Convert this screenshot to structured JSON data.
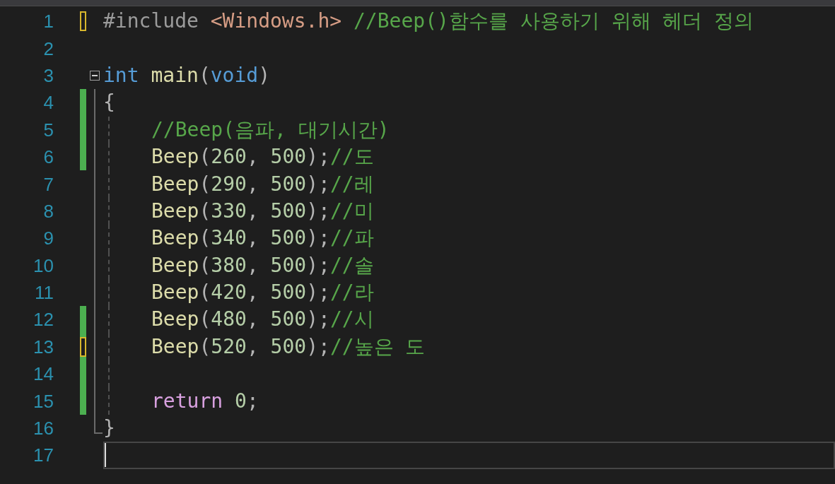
{
  "editor": {
    "lines": [
      {
        "number": "1",
        "change_bar": false,
        "unsaved_marker": true,
        "fold_start": false,
        "fold_end": false,
        "indented": false,
        "current": false,
        "tokens": [
          {
            "kind": "preprocessor",
            "text": "#include "
          },
          {
            "kind": "include",
            "text": "<Windows.h>"
          },
          {
            "kind": "comment",
            "text": " //Beep()함수를 사용하기 위해 헤더 정의"
          }
        ]
      },
      {
        "number": "2",
        "change_bar": false,
        "unsaved_marker": false,
        "fold_start": false,
        "fold_end": false,
        "indented": false,
        "current": false
      },
      {
        "number": "3",
        "change_bar": false,
        "unsaved_marker": false,
        "fold_start": true,
        "fold_end": false,
        "indented": false,
        "current": false,
        "tokens": [
          {
            "kind": "keyword",
            "text": "int"
          },
          {
            "kind": "function",
            "text": " main"
          },
          {
            "kind": "punct",
            "text": "("
          },
          {
            "kind": "keyword",
            "text": "void"
          },
          {
            "kind": "punct",
            "text": ")"
          }
        ]
      },
      {
        "number": "4",
        "change_bar": true,
        "unsaved_marker": false,
        "fold_start": false,
        "fold_end": false,
        "indented": false,
        "current": false,
        "tokens": [
          {
            "kind": "punct",
            "text": "{"
          }
        ]
      },
      {
        "number": "5",
        "change_bar": true,
        "unsaved_marker": false,
        "fold_start": false,
        "fold_end": false,
        "indented": true,
        "current": false,
        "tokens": [
          {
            "kind": "comment",
            "text": "//Beep(음파, 대기시간)"
          }
        ]
      },
      {
        "number": "6",
        "change_bar": true,
        "unsaved_marker": false,
        "fold_start": false,
        "fold_end": false,
        "indented": true,
        "current": false,
        "tokens": [
          {
            "kind": "function",
            "text": "Beep"
          },
          {
            "kind": "punct",
            "text": "("
          },
          {
            "kind": "number",
            "text": "260"
          },
          {
            "kind": "punct",
            "text": ", "
          },
          {
            "kind": "number",
            "text": "500"
          },
          {
            "kind": "punct",
            "text": ");"
          },
          {
            "kind": "comment",
            "text": "//도"
          }
        ]
      },
      {
        "number": "7",
        "change_bar": false,
        "unsaved_marker": false,
        "fold_start": false,
        "fold_end": false,
        "indented": true,
        "current": false,
        "tokens": [
          {
            "kind": "function",
            "text": "Beep"
          },
          {
            "kind": "punct",
            "text": "("
          },
          {
            "kind": "number",
            "text": "290"
          },
          {
            "kind": "punct",
            "text": ", "
          },
          {
            "kind": "number",
            "text": "500"
          },
          {
            "kind": "punct",
            "text": ");"
          },
          {
            "kind": "comment",
            "text": "//레"
          }
        ]
      },
      {
        "number": "8",
        "change_bar": false,
        "unsaved_marker": false,
        "fold_start": false,
        "fold_end": false,
        "indented": true,
        "current": false,
        "tokens": [
          {
            "kind": "function",
            "text": "Beep"
          },
          {
            "kind": "punct",
            "text": "("
          },
          {
            "kind": "number",
            "text": "330"
          },
          {
            "kind": "punct",
            "text": ", "
          },
          {
            "kind": "number",
            "text": "500"
          },
          {
            "kind": "punct",
            "text": ");"
          },
          {
            "kind": "comment",
            "text": "//미"
          }
        ]
      },
      {
        "number": "9",
        "change_bar": false,
        "unsaved_marker": false,
        "fold_start": false,
        "fold_end": false,
        "indented": true,
        "current": false,
        "tokens": [
          {
            "kind": "function",
            "text": "Beep"
          },
          {
            "kind": "punct",
            "text": "("
          },
          {
            "kind": "number",
            "text": "340"
          },
          {
            "kind": "punct",
            "text": ", "
          },
          {
            "kind": "number",
            "text": "500"
          },
          {
            "kind": "punct",
            "text": ");"
          },
          {
            "kind": "comment",
            "text": "//파"
          }
        ]
      },
      {
        "number": "10",
        "change_bar": false,
        "unsaved_marker": false,
        "fold_start": false,
        "fold_end": false,
        "indented": true,
        "current": false,
        "tokens": [
          {
            "kind": "function",
            "text": "Beep"
          },
          {
            "kind": "punct",
            "text": "("
          },
          {
            "kind": "number",
            "text": "380"
          },
          {
            "kind": "punct",
            "text": ", "
          },
          {
            "kind": "number",
            "text": "500"
          },
          {
            "kind": "punct",
            "text": ");"
          },
          {
            "kind": "comment",
            "text": "//솔"
          }
        ]
      },
      {
        "number": "11",
        "change_bar": false,
        "unsaved_marker": false,
        "fold_start": false,
        "fold_end": false,
        "indented": true,
        "current": false,
        "tokens": [
          {
            "kind": "function",
            "text": "Beep"
          },
          {
            "kind": "punct",
            "text": "("
          },
          {
            "kind": "number",
            "text": "420"
          },
          {
            "kind": "punct",
            "text": ", "
          },
          {
            "kind": "number",
            "text": "500"
          },
          {
            "kind": "punct",
            "text": ");"
          },
          {
            "kind": "comment",
            "text": "//라"
          }
        ]
      },
      {
        "number": "12",
        "change_bar": true,
        "unsaved_marker": false,
        "fold_start": false,
        "fold_end": false,
        "indented": true,
        "current": false,
        "tokens": [
          {
            "kind": "function",
            "text": "Beep"
          },
          {
            "kind": "punct",
            "text": "("
          },
          {
            "kind": "number",
            "text": "480"
          },
          {
            "kind": "punct",
            "text": ", "
          },
          {
            "kind": "number",
            "text": "500"
          },
          {
            "kind": "punct",
            "text": ");"
          },
          {
            "kind": "comment",
            "text": "//시"
          }
        ]
      },
      {
        "number": "13",
        "change_bar": true,
        "unsaved_marker": true,
        "fold_start": false,
        "fold_end": false,
        "indented": true,
        "current": false,
        "tokens": [
          {
            "kind": "function",
            "text": "Beep"
          },
          {
            "kind": "punct",
            "text": "("
          },
          {
            "kind": "number",
            "text": "520"
          },
          {
            "kind": "punct",
            "text": ", "
          },
          {
            "kind": "number",
            "text": "500"
          },
          {
            "kind": "punct",
            "text": ");"
          },
          {
            "kind": "comment",
            "text": "//높은 도"
          }
        ]
      },
      {
        "number": "14",
        "change_bar": true,
        "unsaved_marker": false,
        "fold_start": false,
        "fold_end": false,
        "indented": true,
        "current": false
      },
      {
        "number": "15",
        "change_bar": true,
        "unsaved_marker": false,
        "fold_start": false,
        "fold_end": false,
        "indented": true,
        "current": false,
        "tokens": [
          {
            "kind": "control",
            "text": "return"
          },
          {
            "kind": "number",
            "text": " 0"
          },
          {
            "kind": "punct",
            "text": ";"
          }
        ]
      },
      {
        "number": "16",
        "change_bar": false,
        "unsaved_marker": false,
        "fold_start": false,
        "fold_end": true,
        "indented": false,
        "current": false,
        "tokens": [
          {
            "kind": "punct",
            "text": "}"
          }
        ]
      },
      {
        "number": "17",
        "change_bar": false,
        "unsaved_marker": false,
        "fold_start": false,
        "fold_end": false,
        "indented": false,
        "current": true
      }
    ]
  }
}
